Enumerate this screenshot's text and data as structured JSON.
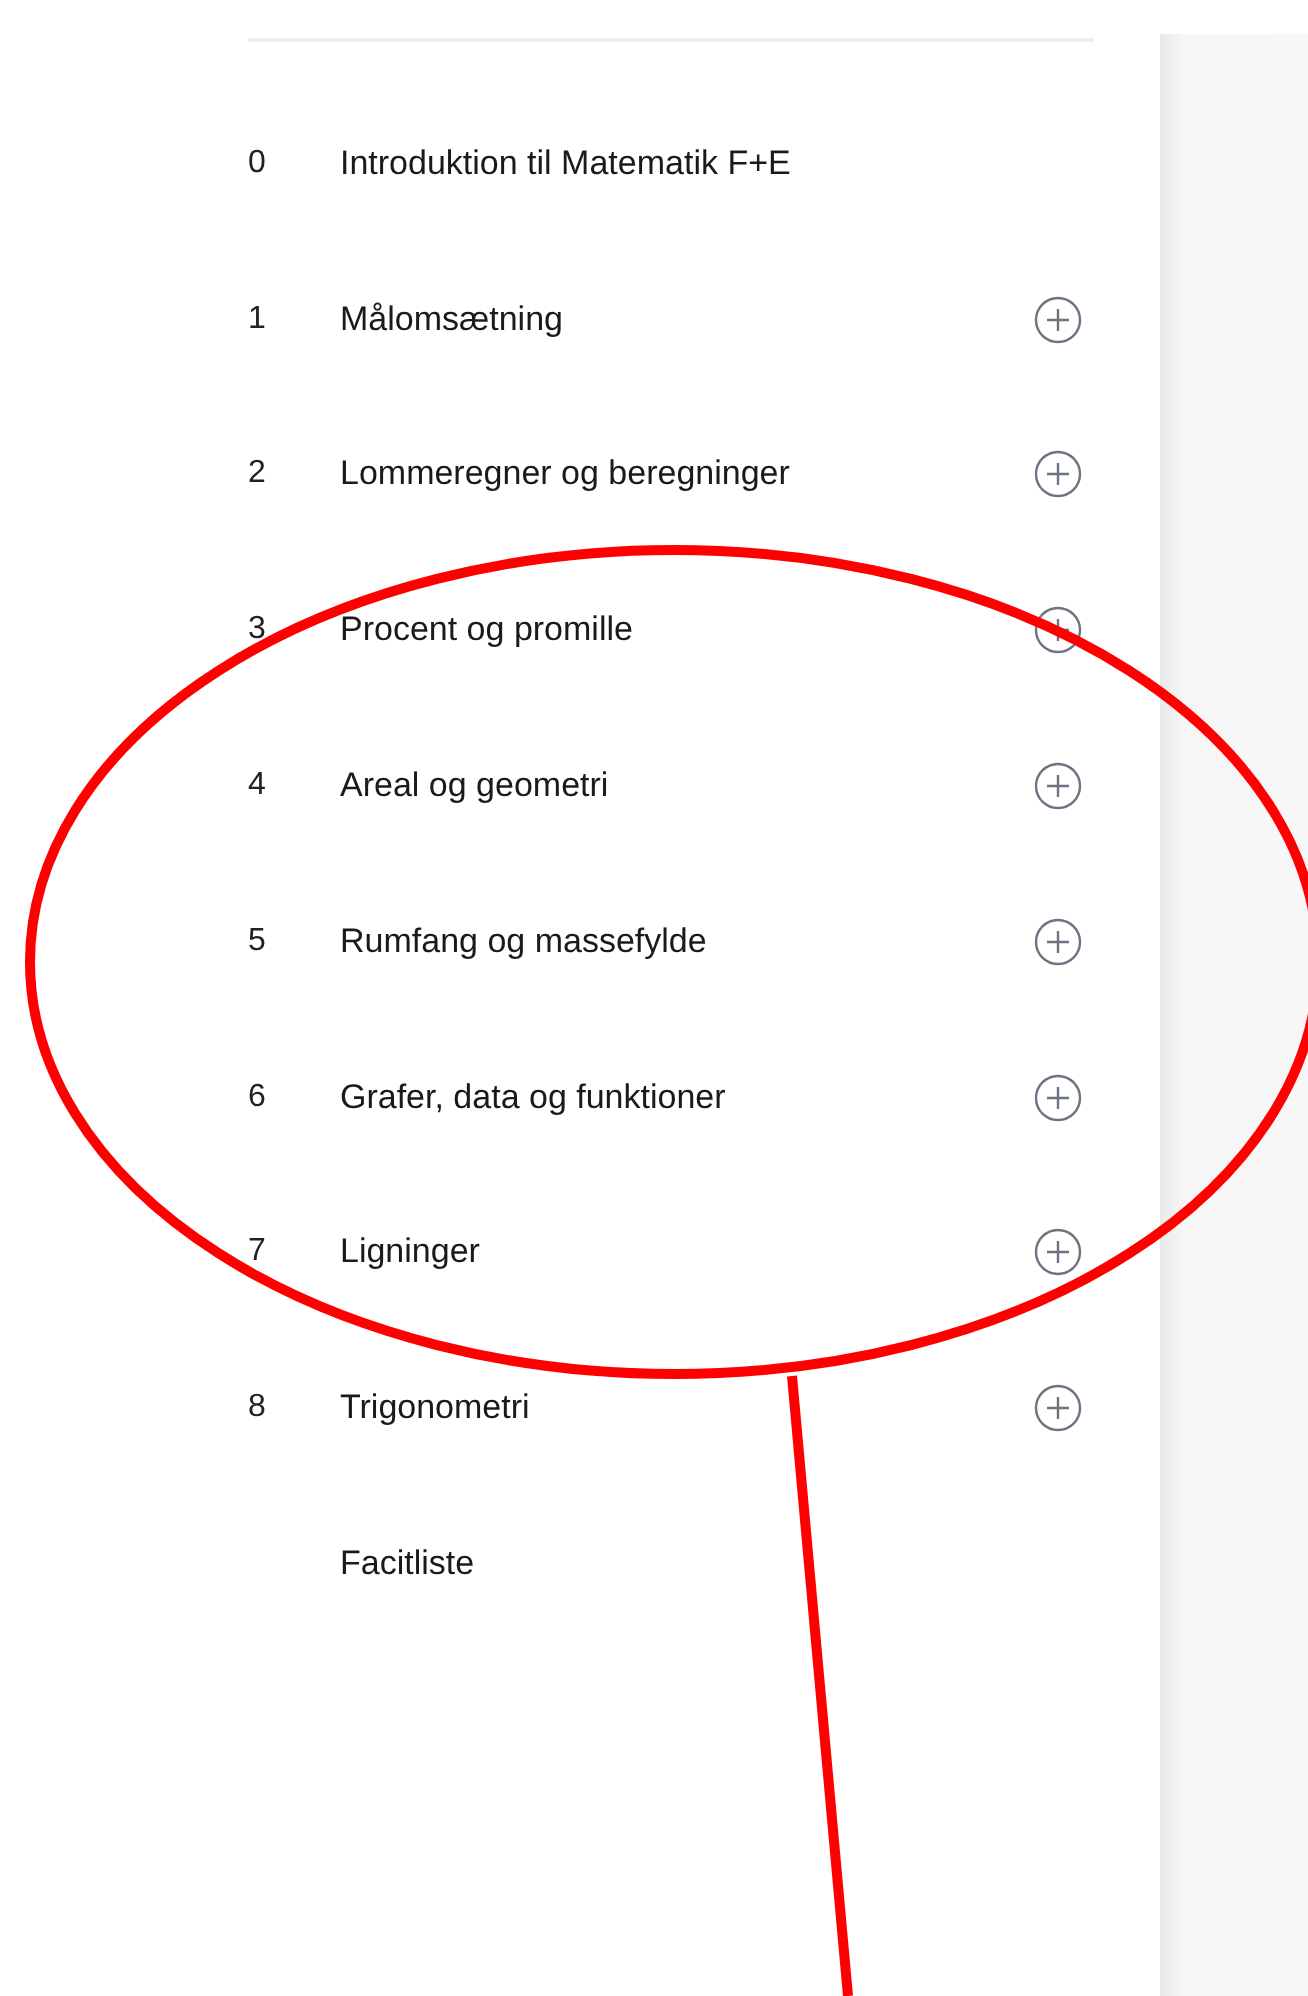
{
  "chapters": [
    {
      "number": "0",
      "title": "Introduktion til Matematik F+E",
      "expandable": false
    },
    {
      "number": "1",
      "title": "Målomsætning",
      "expandable": true
    },
    {
      "number": "2",
      "title": "Lommeregner og beregninger",
      "expandable": true
    },
    {
      "number": "3",
      "title": "Procent og promille",
      "expandable": true
    },
    {
      "number": "4",
      "title": "Areal og geometri",
      "expandable": true
    },
    {
      "number": "5",
      "title": "Rumfang og massefylde",
      "expandable": true
    },
    {
      "number": "6",
      "title": "Grafer, data og funktioner",
      "expandable": true
    },
    {
      "number": "7",
      "title": "Ligninger",
      "expandable": true
    },
    {
      "number": "8",
      "title": "Trigonometri",
      "expandable": true
    },
    {
      "title": "Facitliste",
      "expandable": false
    }
  ]
}
